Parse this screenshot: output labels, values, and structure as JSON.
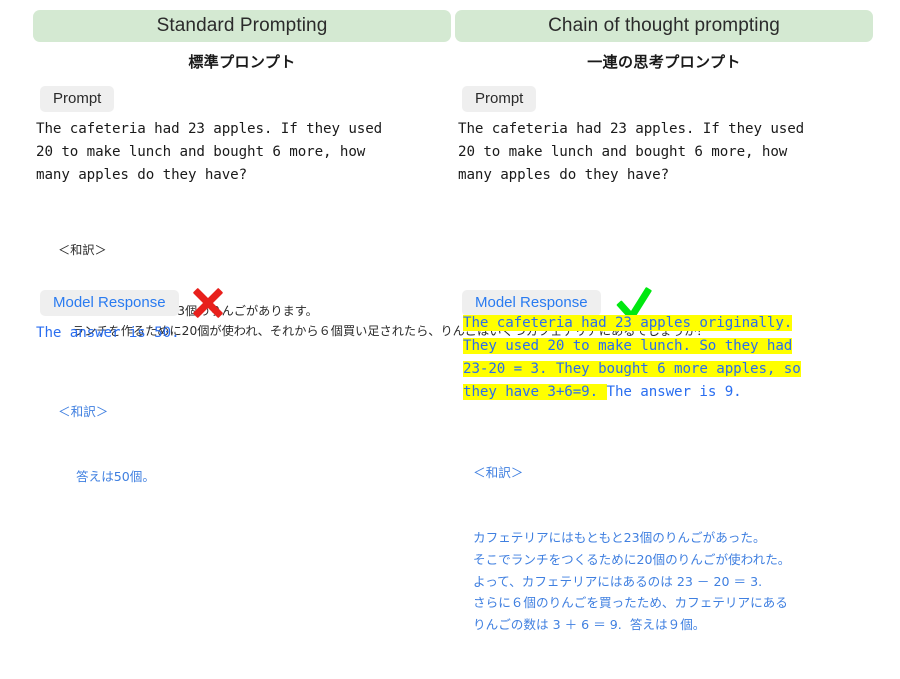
{
  "columns": {
    "left": {
      "header_title": "Standard Prompting",
      "header_subtitle": "標準プロンプト",
      "prompt_label": "Prompt",
      "prompt_text": "The cafeteria had 23 apples. If they used\n20 to make lunch and bought 6 more, how\nmany apples do they have?",
      "prompt_translation_tag": "＜和訳＞",
      "prompt_translation_body": "カフェテリアには23個のりんごがあります。\nランチを作るために20個が使われ、それから６個買い足されたら、りんごはいくつカフェテリアにあるでしょうか？",
      "response_label": "Model Response",
      "response_mark": "cross-mark",
      "response_text": "The answer is 50.",
      "response_translation_tag": "＜和訳＞",
      "response_translation_body": "答えは50個。"
    },
    "right": {
      "header_title": "Chain of thought prompting",
      "header_subtitle": "一連の思考プロンプト",
      "prompt_label": "Prompt",
      "prompt_text": "The cafeteria had 23 apples. If they used\n20 to make lunch and bought 6 more, how\nmany apples do they have?",
      "response_label": "Model Response",
      "response_mark": "check-mark",
      "response_lines": [
        {
          "highlighted": "The cafeteria had 23 apples originally.",
          "plain": ""
        },
        {
          "highlighted": "They used 20 to make lunch. So they had",
          "plain": ""
        },
        {
          "highlighted": "23-20 = 3. They bought 6 more apples, so",
          "plain": ""
        },
        {
          "highlighted": "they have 3+6=9. ",
          "plain": "The answer is 9."
        }
      ],
      "response_translation_tag": "＜和訳＞",
      "response_translation_body": "カフェテリアにはもともと23個のりんごがあった。\nそこでランチをつくるために20個のりんごが使われた。\nよって、カフェテリアにはあるのは 23 － 20 ＝ 3.\nさらに６個のりんごを買ったため、カフェテリアにある\nりんごの数は 3 ＋ 6 ＝ 9.  答えは９個。"
    }
  },
  "colors": {
    "header_green": "#d4e9d2",
    "chip_gray": "#efefef",
    "response_blue": "#2a7bf0",
    "highlight_yellow": "#ffff00",
    "cross_red": "#e8201c",
    "check_green": "#00e810",
    "background": "#ffffff"
  }
}
